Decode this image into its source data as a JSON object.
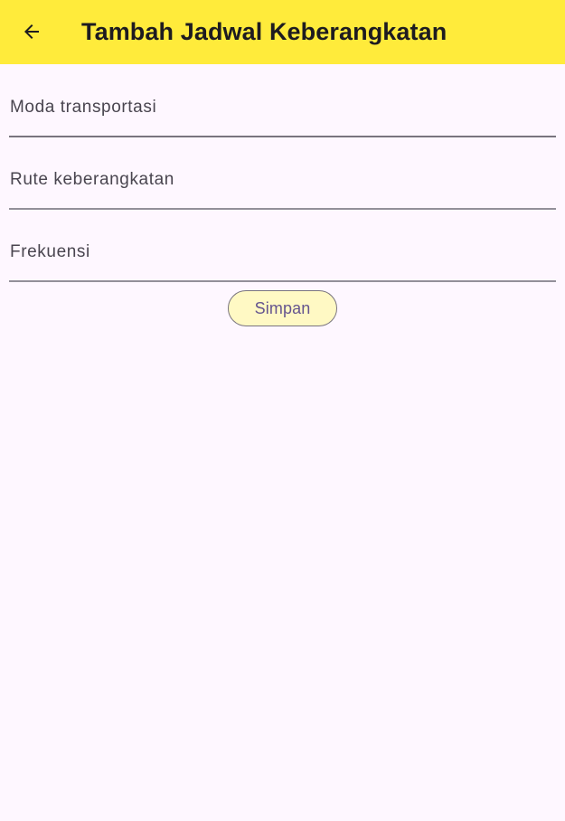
{
  "app_bar": {
    "title": "Tambah Jadwal Keberangkatan",
    "back_icon": "arrow-back-icon",
    "background_color": "#ffeb3b"
  },
  "form": {
    "fields": [
      {
        "label": "Moda transportasi",
        "value": ""
      },
      {
        "label": "Rute keberangkatan",
        "value": ""
      },
      {
        "label": "Frekuensi",
        "value": ""
      }
    ],
    "save_label": "Simpan"
  },
  "colors": {
    "background": "#fef7ff",
    "button_fill": "#fff9c4",
    "button_text": "#65558f"
  }
}
